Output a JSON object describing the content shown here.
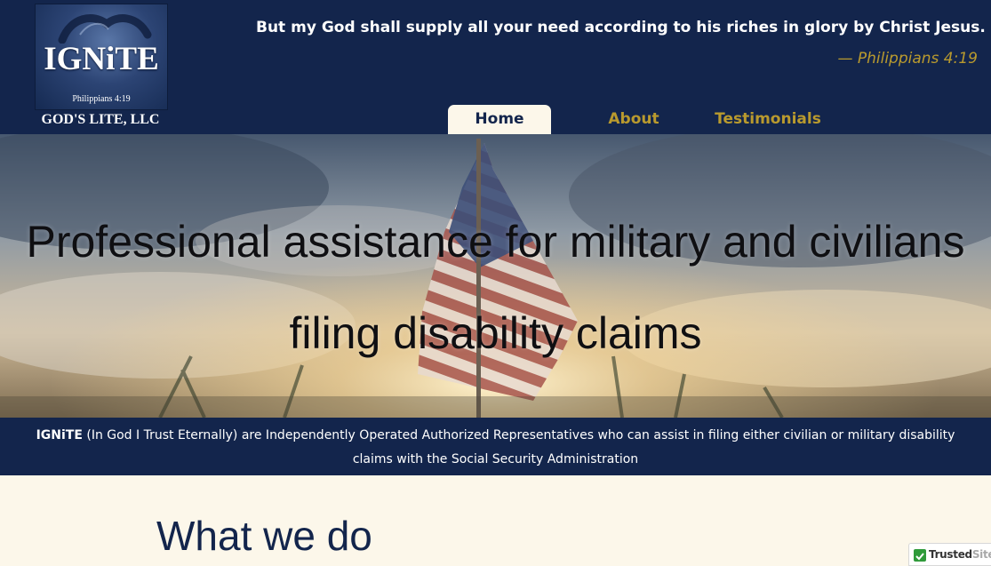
{
  "header": {
    "logo": {
      "word": "IGNiTE",
      "verse": "Philippians 4:19",
      "company": "GOD'S LITE, LLC"
    },
    "quote": "But my God shall supply all your need according to his riches in glory by Christ Jesus.",
    "quote_ref": "— Philippians 4:19"
  },
  "nav": {
    "items": [
      {
        "label": "Home",
        "active": true
      },
      {
        "label": "About",
        "active": false
      },
      {
        "label": "Testimonials",
        "active": false
      }
    ]
  },
  "hero": {
    "title_line1": "Professional assistance for military and civilians",
    "title_line2": "filing disability claims"
  },
  "band": {
    "brand": "IGNiTE",
    "text": " (In God I Trust Eternally) are Independently Operated Authorized Representatives who can assist in filing either civilian or military disability claims with the Social Security Administration"
  },
  "section": {
    "heading": "What we do"
  },
  "badge": {
    "trusted": "Trusted",
    "site": "Site"
  },
  "colors": {
    "navy": "#13254c",
    "gold": "#b99a2e",
    "cream": "#fcf7ea"
  }
}
